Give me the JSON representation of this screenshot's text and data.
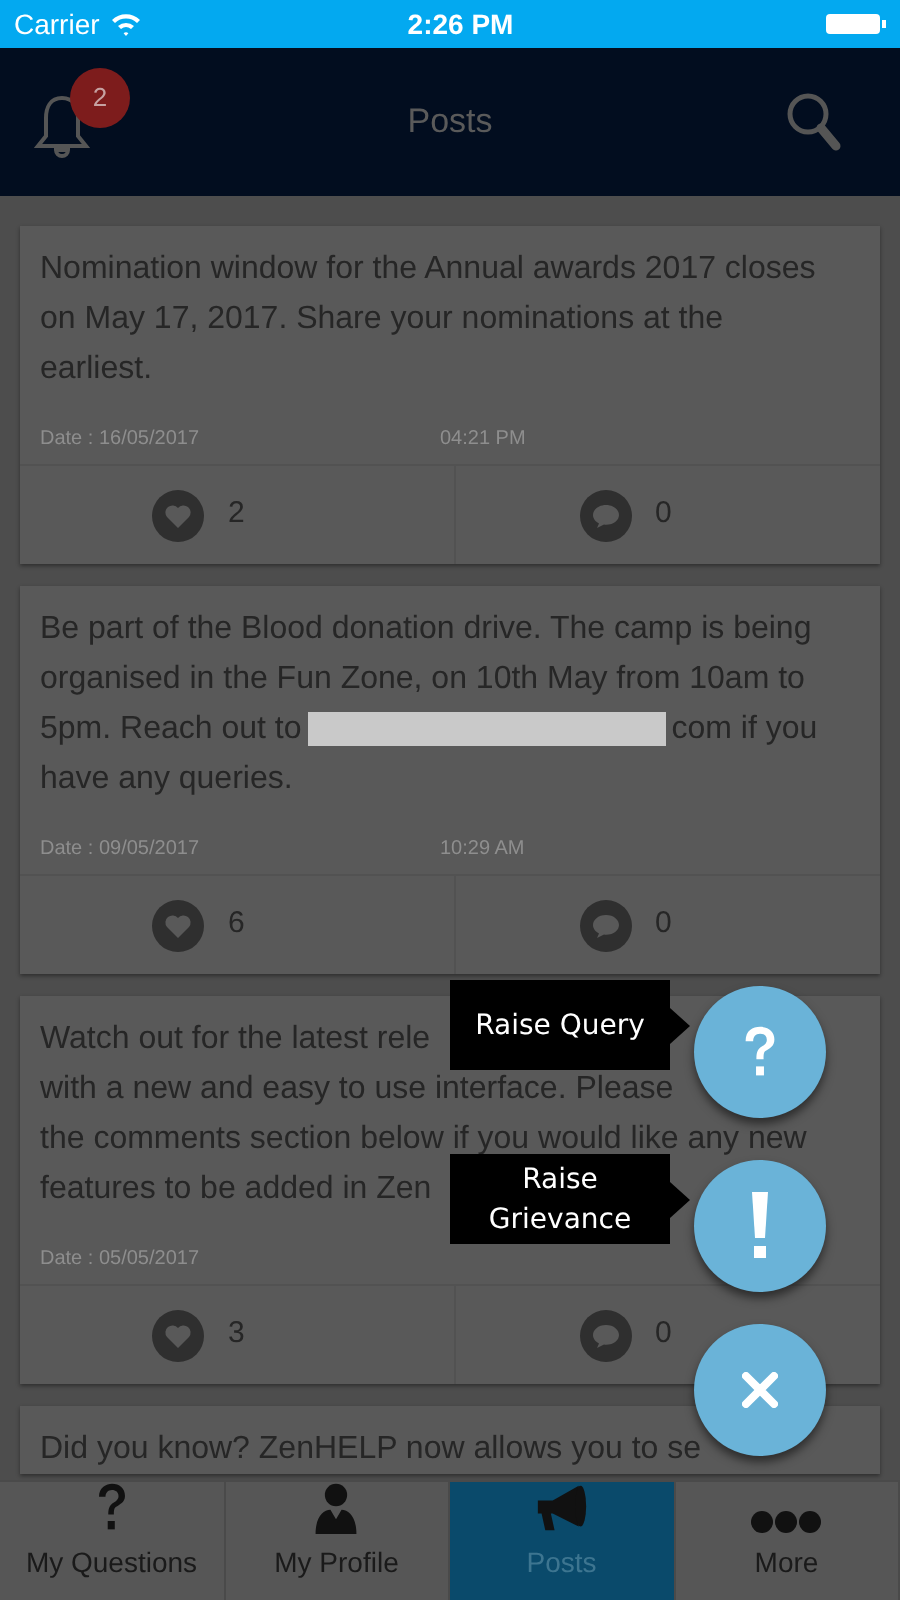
{
  "status_bar": {
    "carrier": "Carrier",
    "time": "2:26 PM"
  },
  "header": {
    "title": "Posts",
    "notification_count": "2"
  },
  "posts": [
    {
      "lines": [
        [
          {
            "kind": "text",
            "text": "Nomination window for the Annual awards 2017 closes"
          }
        ],
        [
          {
            "kind": "text",
            "text": "on May 17, 2017. Share your nominations at the"
          }
        ],
        [
          {
            "kind": "text",
            "text": "earliest."
          }
        ]
      ],
      "date": "Date : 16/05/2017",
      "time": "04:21 PM",
      "likes": "2",
      "comments": "0"
    },
    {
      "lines": [
        [
          {
            "kind": "text",
            "text": "Be part of the Blood donation drive. The camp is being"
          }
        ],
        [
          {
            "kind": "text",
            "text": "organised in the Fun Zone, on 10th May from 10am to"
          }
        ],
        [
          {
            "kind": "text",
            "text": "5pm. Reach out to"
          },
          {
            "kind": "redacted"
          },
          {
            "kind": "text",
            "text": "com if you"
          }
        ],
        [
          {
            "kind": "text",
            "text": "have any queries."
          }
        ]
      ],
      "date": "Date : 09/05/2017",
      "time": "10:29 AM",
      "likes": "6",
      "comments": "0"
    },
    {
      "lines": [
        [
          {
            "kind": "text",
            "text": "Watch out for the latest rele"
          }
        ],
        [
          {
            "kind": "text",
            "text": "with a new and easy to use interface. Please"
          }
        ],
        [
          {
            "kind": "text",
            "text": "the comments section below if you would like any new"
          }
        ],
        [
          {
            "kind": "text",
            "text": "features to be added in Zen"
          }
        ]
      ],
      "date": "Date : 05/05/2017",
      "likes": "3",
      "comments": "0"
    },
    {
      "lines": [
        [
          {
            "kind": "text",
            "text": "Did you know? ZenHELP now allows you to se"
          }
        ]
      ]
    }
  ],
  "actions": [
    {
      "kind": "query",
      "label": "Raise Query"
    },
    {
      "kind": "grievance",
      "label": "Raise Grievance"
    },
    {
      "kind": "close"
    }
  ],
  "tabs": [
    {
      "kind": "question",
      "label": "My Questions",
      "selected": false
    },
    {
      "kind": "profile",
      "label": "My Profile",
      "selected": false
    },
    {
      "kind": "megaphone",
      "label": "Posts",
      "selected": true
    },
    {
      "kind": "more",
      "label": "More",
      "selected": false
    }
  ]
}
